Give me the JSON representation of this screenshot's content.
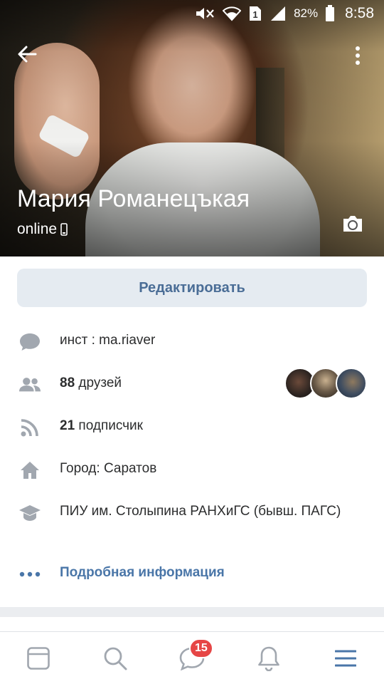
{
  "status_bar": {
    "battery_percent": "82%",
    "time": "8:58",
    "sim_label": "1",
    "icons": [
      "mute-icon",
      "wifi-icon",
      "sim-icon",
      "signal-icon",
      "battery-icon"
    ]
  },
  "profile": {
    "name": "Мария Романецъкая",
    "status": "online",
    "status_icon": "mobile-icon"
  },
  "actions": {
    "edit_label": "Редактировать"
  },
  "info": {
    "about": "инст : ma.riaver",
    "friends_count": "88",
    "friends_word": "друзей",
    "followers_count": "21",
    "followers_word": "подписчик",
    "city": "Город: Саратов",
    "education": "ПИУ им. Столыпина РАНХиГС (бывш. ПАГС)",
    "more_label": "Подробная информация"
  },
  "bottom_nav": {
    "items": [
      "news-icon",
      "search-icon",
      "messages-icon",
      "notifications-icon",
      "menu-icon"
    ],
    "messages_badge": "15"
  },
  "colors": {
    "accent": "#4a76a8",
    "button_bg": "#e5ebf1",
    "button_text": "#4a6d96",
    "icon_gray": "#a1a7af",
    "badge_red": "#e64646"
  }
}
